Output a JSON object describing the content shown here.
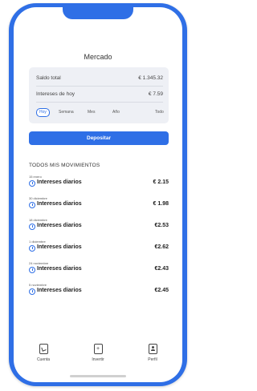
{
  "header": {
    "title": "Mercado"
  },
  "summary": {
    "saldo_label": "Saldo total",
    "saldo_value": "€ 1.345.32",
    "intereses_label": "Intereses de hoy",
    "intereses_value": "€ 7.59",
    "periods": [
      "Hoy",
      "Semana",
      "Mes",
      "Año",
      "Todo"
    ],
    "active_period": "Hoy"
  },
  "actions": {
    "deposit_label": "Depositar"
  },
  "movements": {
    "section_title": "TODOS MIS MOVIMIENTOS",
    "items": [
      {
        "date": "15 enero",
        "label": "Intereses diarios",
        "amount": "€ 2.15"
      },
      {
        "date": "30 diciembre",
        "label": "Intereses diarios",
        "amount": "€ 1.98"
      },
      {
        "date": "18 diciembre",
        "label": "Intereses diarios",
        "amount": "€2.53"
      },
      {
        "date": "1 diciembre",
        "label": "Intereses diarios",
        "amount": "€2.62"
      },
      {
        "date": "24 noviembre",
        "label": "Intereses diarios",
        "amount": "€2.43"
      },
      {
        "date": "5 noviembre",
        "label": "Intereses diarios",
        "amount": "€2.45"
      }
    ]
  },
  "tabbar": {
    "items": [
      {
        "label": "Cuenta",
        "icon": "wallet-icon"
      },
      {
        "label": "Invertir",
        "icon": "plus-icon"
      },
      {
        "label": "Perfil",
        "icon": "profile-icon"
      }
    ]
  },
  "colors": {
    "accent": "#2f6fe6",
    "card_bg": "#eef0f5"
  }
}
